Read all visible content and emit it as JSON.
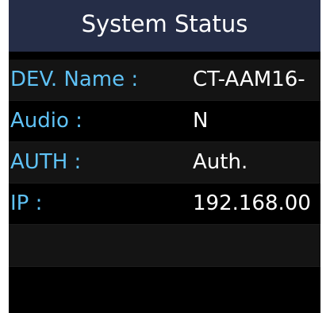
{
  "header": {
    "title": "System Status"
  },
  "rows": [
    {
      "label": "DEV. Name :",
      "value": "CT-AAM16-"
    },
    {
      "label": "Audio :",
      "value": "N"
    },
    {
      "label": "AUTH :",
      "value": "Auth."
    },
    {
      "label": "IP :",
      "value": "192.168.00"
    }
  ],
  "colors": {
    "title_bar": "#252d47",
    "label_text": "#5fc2f6",
    "value_text": "#ffffff",
    "row_alt": "#141414",
    "background": "#000000"
  }
}
